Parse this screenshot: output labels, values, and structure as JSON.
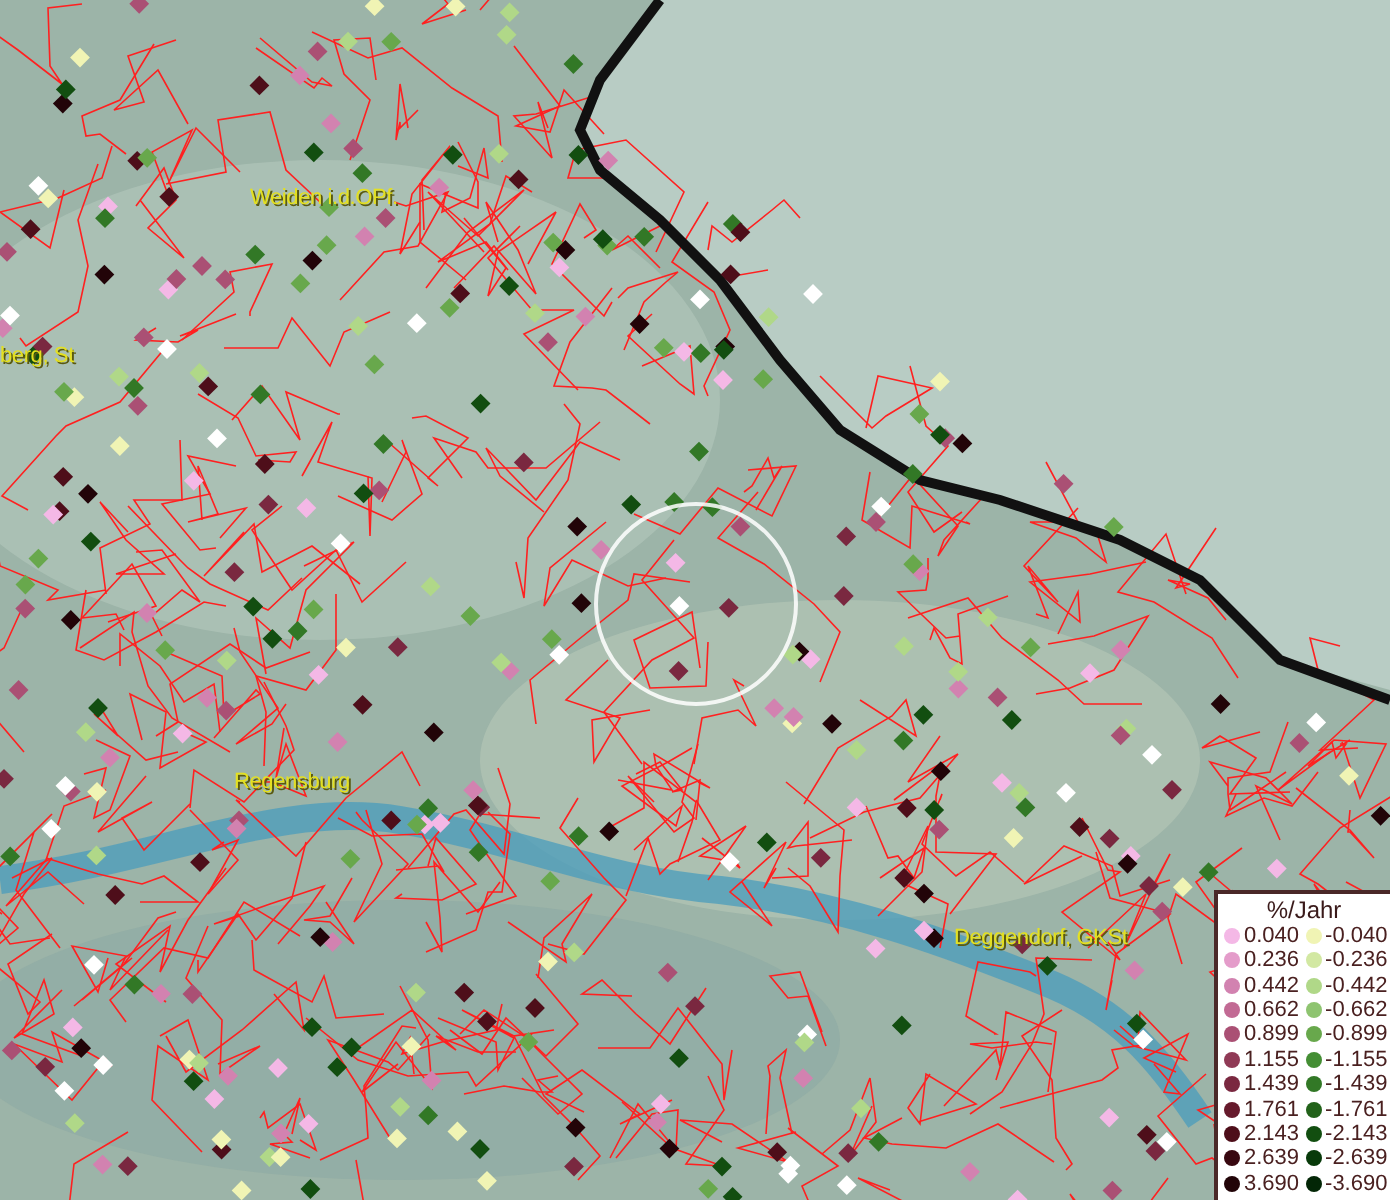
{
  "map": {
    "place_labels": [
      {
        "text": "Weiden i.d.OPf."
      },
      {
        "text": "berg, St"
      },
      {
        "text": "Regensburg"
      },
      {
        "text": "Deggendorf, GKSt"
      }
    ]
  },
  "legend": {
    "title": "%/Jahr",
    "columns": [
      [
        {
          "label": "0.040",
          "color": "#f4b8e6"
        },
        {
          "label": "0.236",
          "color": "#e49cca"
        },
        {
          "label": "0.442",
          "color": "#d282b0"
        },
        {
          "label": "0.662",
          "color": "#c26a94"
        },
        {
          "label": "0.899",
          "color": "#aa5074"
        },
        {
          "label": "1.155",
          "color": "#903a56"
        },
        {
          "label": "1.439",
          "color": "#7a2840"
        },
        {
          "label": "1.761",
          "color": "#661a2c"
        },
        {
          "label": "2.143",
          "color": "#4e0e1a"
        },
        {
          "label": "2.639",
          "color": "#380810"
        },
        {
          "label": "3.690",
          "color": "#220408"
        }
      ],
      [
        {
          "label": "-0.040",
          "color": "#f0f4b4"
        },
        {
          "label": "-0.236",
          "color": "#d2e8a2"
        },
        {
          "label": "-0.442",
          "color": "#b0d888"
        },
        {
          "label": "-0.662",
          "color": "#8ec470"
        },
        {
          "label": "-0.899",
          "color": "#68a84c"
        },
        {
          "label": "-1.155",
          "color": "#448e34"
        },
        {
          "label": "-1.439",
          "color": "#327826"
        },
        {
          "label": "-1.761",
          "color": "#22621a"
        },
        {
          "label": "-2.143",
          "color": "#124e10"
        },
        {
          "label": "-2.639",
          "color": "#083a0a"
        },
        {
          "label": "-3.690",
          "color": "#032606"
        }
      ]
    ]
  }
}
